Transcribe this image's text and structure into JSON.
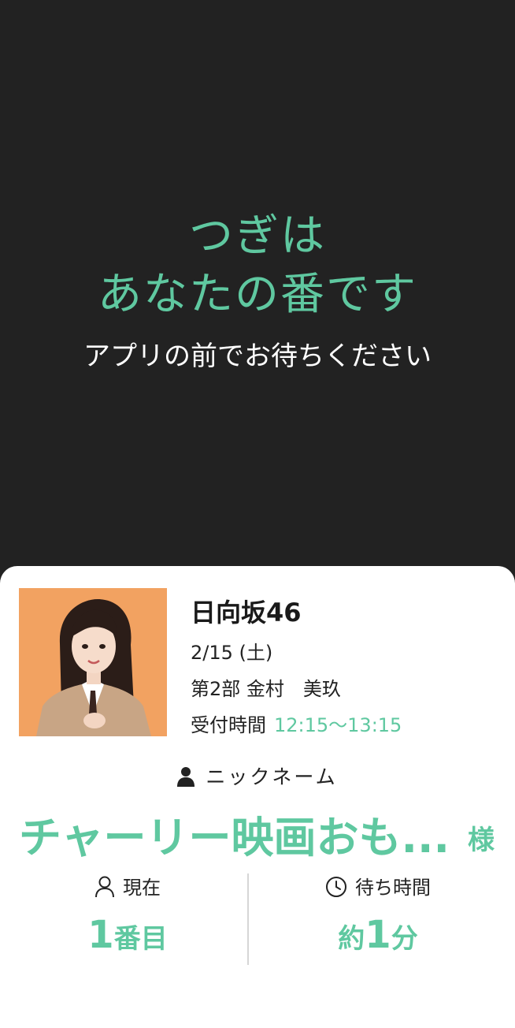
{
  "banner": {
    "line1": "つぎは",
    "line2": "あなたの番です",
    "subtitle": "アプリの前でお待ちください"
  },
  "ticket": {
    "group": "日向坂46",
    "date": "2/15 (土)",
    "part": "第2部  金村　美玖",
    "reception_label": "受付時間",
    "reception_time": "12:15～13:15",
    "nickname_label": "ニックネーム",
    "nickname": "チャーリー映画おも...",
    "honorific": "様",
    "current_label": "現在",
    "current_number": "1",
    "current_unit": "番目",
    "wait_label": "待ち時間",
    "wait_prefix": "約",
    "wait_number": "1",
    "wait_unit": "分"
  },
  "colors": {
    "accent": "#5fc8a0",
    "background": "#222222",
    "photo_bg": "#f2a261"
  },
  "icons": [
    "person-icon",
    "user-outline-icon",
    "clock-icon"
  ]
}
